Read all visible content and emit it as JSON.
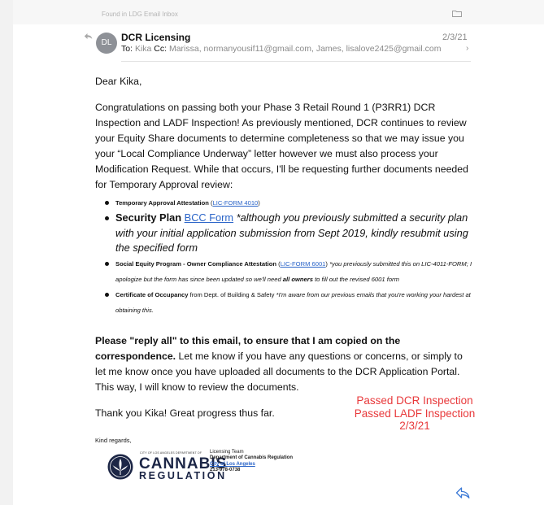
{
  "header": {
    "found_in": "Found in LDG Email Inbox",
    "folder_icon": "folder-icon"
  },
  "message": {
    "avatar_initials": "DL",
    "sender": "DCR Licensing",
    "date": "2/3/21",
    "to_label": "To:",
    "to": "Kika",
    "cc_label": "Cc:",
    "cc": "Marissa, normanyousif11@gmail.com, James, lisalove2425@gmail.com",
    "chevron": "›"
  },
  "body": {
    "greeting": "Dear Kika,",
    "para1": "Congratulations on passing both your Phase 3 Retail Round 1 (P3RR1) DCR Inspection and LADF Inspection! As previously mentioned, DCR continues to review your Equity Share documents to determine completeness so that we may issue you your “Local Compliance Underway” letter however we must also process your Modification Request. While that occurs, I'll be requesting further documents needed for Temporary Approval review:",
    "items": [
      {
        "title": "Temporary Approval Attestation",
        "open": " (",
        "link": "LIC-FORM 4010",
        "close": ")"
      },
      {
        "title": "Security Plan",
        "link": "BCC Form",
        "note": "*although you previously submitted a security plan with your initial application submission from Sept 2019, kindly resubmit using the specified form"
      },
      {
        "title": "Social Equity Program - Owner Compliance Attestation",
        "open": " (",
        "link": "LIC-FORM 6001",
        "close": ")",
        "note1": "*you previously submitted this on LIC-4011-FORM; I apologize but the form has since been updated so we'll need",
        "note_bold": "all owners",
        "note2": "to fill out the revised 6001 form"
      },
      {
        "title": "Certificate of Occupancy",
        "text": " from Dept. of Building & Safety ",
        "note": "*I'm aware from our previous emails that you're working your hardest at obtaining this."
      }
    ],
    "para2_bold": "Please \"reply all\" to this email, to ensure that I am copied on the correspondence.",
    "para2": " Let me know if you have any questions or concerns, or simply to let me know once you have uploaded all documents to the DCR Application Portal. This way, I will know to review the documents.",
    "thanks": "Thank you Kika! Great progress thus far.",
    "regards": "Kind regards,"
  },
  "annotation": {
    "line1": "Passed DCR Inspection",
    "line2": "Passed LADF Inspection",
    "line3": "2/3/21",
    "color": "#e8393b"
  },
  "signature": {
    "logo_top": "CITY OF LOS ANGELES DEPARTMENT OF",
    "logo_main": "CANNABIS",
    "logo_sub": "REGULATION",
    "team": "Licensing Team",
    "dept": "Department of Cannabis Regulation",
    "city": "City of Los Angeles",
    "phone": "213-978-0738"
  },
  "actions": {
    "reply_icon": "reply-icon"
  }
}
